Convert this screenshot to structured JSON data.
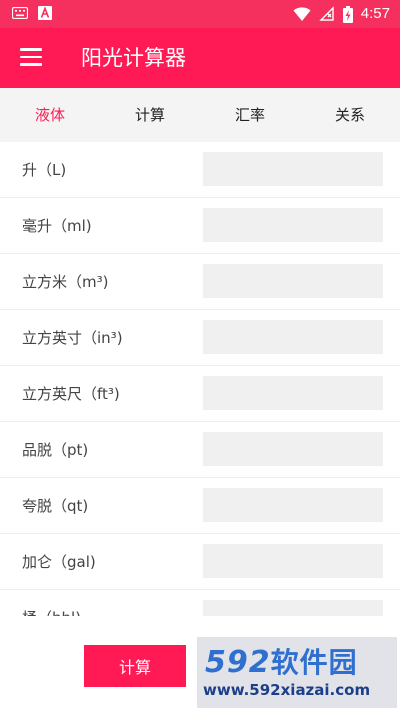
{
  "status_bar": {
    "time": "4:57",
    "left_icons": [
      "keyboard-icon",
      "font-a-icon"
    ],
    "right_icons": [
      "wifi-icon",
      "no-sim-icon",
      "battery-charging-icon"
    ]
  },
  "app_bar": {
    "title": "阳光计算器",
    "color": "#ff1a55"
  },
  "tabs": [
    {
      "label": "液体",
      "active": true
    },
    {
      "label": "计算",
      "active": false
    },
    {
      "label": "汇率",
      "active": false
    },
    {
      "label": "关系",
      "active": false
    }
  ],
  "units": [
    {
      "label": "升（L)",
      "value": ""
    },
    {
      "label": "毫升（ml)",
      "value": ""
    },
    {
      "label": "立方米（m³)",
      "value": ""
    },
    {
      "label": "立方英寸（in³)",
      "value": ""
    },
    {
      "label": "立方英尺（ft³)",
      "value": ""
    },
    {
      "label": "品脱（pt)",
      "value": ""
    },
    {
      "label": "夸脱（qt)",
      "value": ""
    },
    {
      "label": "加仑（gal)",
      "value": ""
    },
    {
      "label": "桶（bbl)",
      "value": ""
    }
  ],
  "actions": {
    "calculate_label": "计算"
  },
  "watermark": {
    "logo_number": "592",
    "logo_text": "软件园",
    "url": "www.592xiazai.com"
  }
}
